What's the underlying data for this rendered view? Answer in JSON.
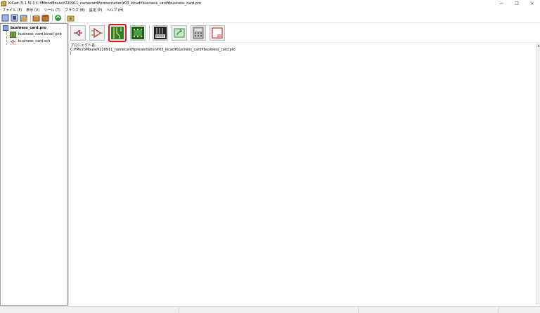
{
  "window": {
    "title": "KiCad (5.1.5)-1 C:¥MicroMouse¥220911_namecard¥presentation¥03_kicad¥business_card¥business_card.pro"
  },
  "menubar": {
    "items": [
      {
        "label": "ファイル (F)"
      },
      {
        "label": "表示 (V)"
      },
      {
        "label": "ツール (T)"
      },
      {
        "label": "ブラウズ (B)"
      },
      {
        "label": "設定 (P)"
      },
      {
        "label": "ヘルプ (H)"
      }
    ]
  },
  "toolbar": {
    "icons": [
      "new-project-icon",
      "new-from-template-icon",
      "open-project-icon",
      "save-project-icon",
      "archive-icon",
      "unarchive-icon",
      "refresh-icon",
      "open-folder-icon"
    ]
  },
  "tree": {
    "root": {
      "label": "business_card.pro",
      "icon": "project-icon"
    },
    "children": [
      {
        "label": "business_card.kicad_pcb",
        "icon": "pcb-file-icon"
      },
      {
        "label": "business_card.sch",
        "icon": "schematic-file-icon"
      }
    ]
  },
  "launcher": {
    "buttons": [
      {
        "name": "schematic-editor",
        "icon": "eeschema-icon"
      },
      {
        "name": "symbol-editor",
        "icon": "libedit-icon"
      },
      {
        "name": "pcb-editor",
        "icon": "pcbnew-icon",
        "highlighted": true
      },
      {
        "name": "footprint-editor",
        "icon": "modedit-icon"
      },
      {
        "name": "gerber-viewer",
        "icon": "gerbview-icon"
      },
      {
        "name": "bitmap2component",
        "icon": "bitmap2component-icon"
      },
      {
        "name": "pcb-calculator",
        "icon": "calculator-icon"
      },
      {
        "name": "page-layout-editor",
        "icon": "pagelayout-icon"
      }
    ],
    "highlight_color": "#d21c1c"
  },
  "messages": {
    "line1": "プロジェクト名:",
    "line2": "C:¥MicroMouse¥220911_namecard¥presentation¥03_kicad¥business_card¥business_card.pro"
  }
}
